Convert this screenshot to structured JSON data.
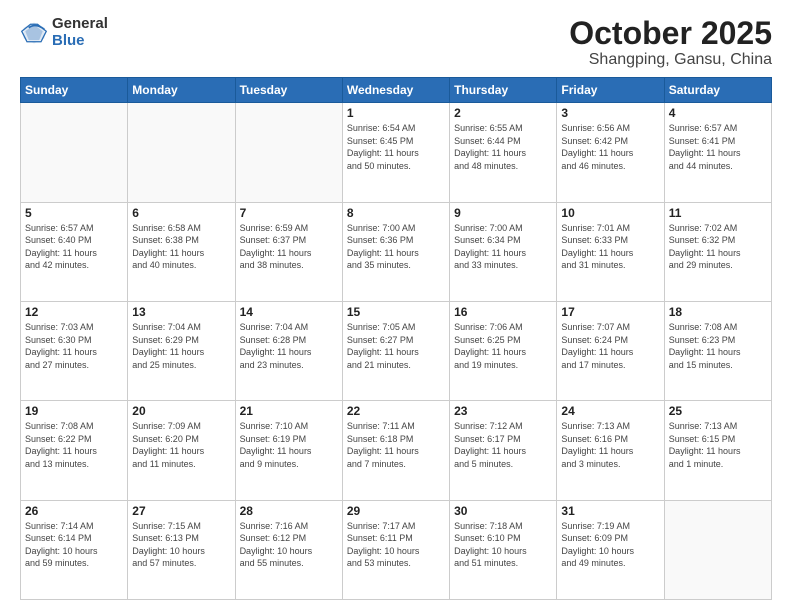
{
  "logo": {
    "general": "General",
    "blue": "Blue"
  },
  "title": {
    "month": "October 2025",
    "location": "Shangping, Gansu, China"
  },
  "days_of_week": [
    "Sunday",
    "Monday",
    "Tuesday",
    "Wednesday",
    "Thursday",
    "Friday",
    "Saturday"
  ],
  "weeks": [
    [
      {
        "day": "",
        "info": ""
      },
      {
        "day": "",
        "info": ""
      },
      {
        "day": "",
        "info": ""
      },
      {
        "day": "1",
        "info": "Sunrise: 6:54 AM\nSunset: 6:45 PM\nDaylight: 11 hours\nand 50 minutes."
      },
      {
        "day": "2",
        "info": "Sunrise: 6:55 AM\nSunset: 6:44 PM\nDaylight: 11 hours\nand 48 minutes."
      },
      {
        "day": "3",
        "info": "Sunrise: 6:56 AM\nSunset: 6:42 PM\nDaylight: 11 hours\nand 46 minutes."
      },
      {
        "day": "4",
        "info": "Sunrise: 6:57 AM\nSunset: 6:41 PM\nDaylight: 11 hours\nand 44 minutes."
      }
    ],
    [
      {
        "day": "5",
        "info": "Sunrise: 6:57 AM\nSunset: 6:40 PM\nDaylight: 11 hours\nand 42 minutes."
      },
      {
        "day": "6",
        "info": "Sunrise: 6:58 AM\nSunset: 6:38 PM\nDaylight: 11 hours\nand 40 minutes."
      },
      {
        "day": "7",
        "info": "Sunrise: 6:59 AM\nSunset: 6:37 PM\nDaylight: 11 hours\nand 38 minutes."
      },
      {
        "day": "8",
        "info": "Sunrise: 7:00 AM\nSunset: 6:36 PM\nDaylight: 11 hours\nand 35 minutes."
      },
      {
        "day": "9",
        "info": "Sunrise: 7:00 AM\nSunset: 6:34 PM\nDaylight: 11 hours\nand 33 minutes."
      },
      {
        "day": "10",
        "info": "Sunrise: 7:01 AM\nSunset: 6:33 PM\nDaylight: 11 hours\nand 31 minutes."
      },
      {
        "day": "11",
        "info": "Sunrise: 7:02 AM\nSunset: 6:32 PM\nDaylight: 11 hours\nand 29 minutes."
      }
    ],
    [
      {
        "day": "12",
        "info": "Sunrise: 7:03 AM\nSunset: 6:30 PM\nDaylight: 11 hours\nand 27 minutes."
      },
      {
        "day": "13",
        "info": "Sunrise: 7:04 AM\nSunset: 6:29 PM\nDaylight: 11 hours\nand 25 minutes."
      },
      {
        "day": "14",
        "info": "Sunrise: 7:04 AM\nSunset: 6:28 PM\nDaylight: 11 hours\nand 23 minutes."
      },
      {
        "day": "15",
        "info": "Sunrise: 7:05 AM\nSunset: 6:27 PM\nDaylight: 11 hours\nand 21 minutes."
      },
      {
        "day": "16",
        "info": "Sunrise: 7:06 AM\nSunset: 6:25 PM\nDaylight: 11 hours\nand 19 minutes."
      },
      {
        "day": "17",
        "info": "Sunrise: 7:07 AM\nSunset: 6:24 PM\nDaylight: 11 hours\nand 17 minutes."
      },
      {
        "day": "18",
        "info": "Sunrise: 7:08 AM\nSunset: 6:23 PM\nDaylight: 11 hours\nand 15 minutes."
      }
    ],
    [
      {
        "day": "19",
        "info": "Sunrise: 7:08 AM\nSunset: 6:22 PM\nDaylight: 11 hours\nand 13 minutes."
      },
      {
        "day": "20",
        "info": "Sunrise: 7:09 AM\nSunset: 6:20 PM\nDaylight: 11 hours\nand 11 minutes."
      },
      {
        "day": "21",
        "info": "Sunrise: 7:10 AM\nSunset: 6:19 PM\nDaylight: 11 hours\nand 9 minutes."
      },
      {
        "day": "22",
        "info": "Sunrise: 7:11 AM\nSunset: 6:18 PM\nDaylight: 11 hours\nand 7 minutes."
      },
      {
        "day": "23",
        "info": "Sunrise: 7:12 AM\nSunset: 6:17 PM\nDaylight: 11 hours\nand 5 minutes."
      },
      {
        "day": "24",
        "info": "Sunrise: 7:13 AM\nSunset: 6:16 PM\nDaylight: 11 hours\nand 3 minutes."
      },
      {
        "day": "25",
        "info": "Sunrise: 7:13 AM\nSunset: 6:15 PM\nDaylight: 11 hours\nand 1 minute."
      }
    ],
    [
      {
        "day": "26",
        "info": "Sunrise: 7:14 AM\nSunset: 6:14 PM\nDaylight: 10 hours\nand 59 minutes."
      },
      {
        "day": "27",
        "info": "Sunrise: 7:15 AM\nSunset: 6:13 PM\nDaylight: 10 hours\nand 57 minutes."
      },
      {
        "day": "28",
        "info": "Sunrise: 7:16 AM\nSunset: 6:12 PM\nDaylight: 10 hours\nand 55 minutes."
      },
      {
        "day": "29",
        "info": "Sunrise: 7:17 AM\nSunset: 6:11 PM\nDaylight: 10 hours\nand 53 minutes."
      },
      {
        "day": "30",
        "info": "Sunrise: 7:18 AM\nSunset: 6:10 PM\nDaylight: 10 hours\nand 51 minutes."
      },
      {
        "day": "31",
        "info": "Sunrise: 7:19 AM\nSunset: 6:09 PM\nDaylight: 10 hours\nand 49 minutes."
      },
      {
        "day": "",
        "info": ""
      }
    ]
  ]
}
